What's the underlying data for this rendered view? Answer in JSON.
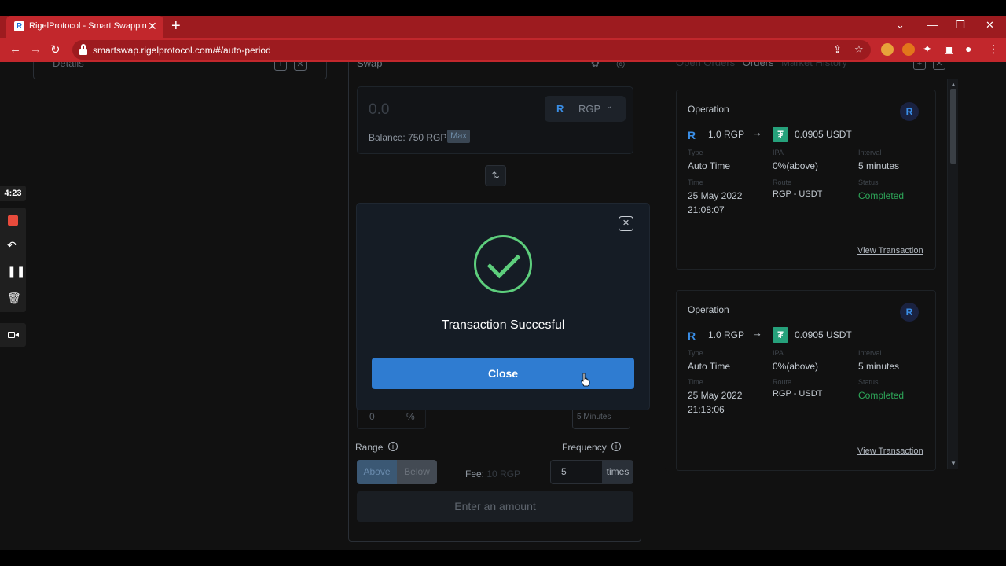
{
  "browser": {
    "tab_title": "RigelProtocol - Smart Swapping",
    "tab_favicon": "R",
    "url": "smartswap.rigelprotocol.com/#/auto-period",
    "accent_color": "#c2272c"
  },
  "recorder": {
    "time": "4:23"
  },
  "details_panel": {
    "title": "Details"
  },
  "swap": {
    "title": "Swap",
    "amount_placeholder": "0.0",
    "token": "RGP",
    "balance": "Balance: 750 RGP",
    "max_label": "Max",
    "percent_value": "0",
    "percent_sign": "%",
    "interval_value": "5 Minutes",
    "range_label": "Range",
    "range_above": "Above",
    "range_below": "Below",
    "fee_label": "Fee:",
    "fee_value": "10 RGP",
    "frequency_label": "Frequency",
    "frequency_value": "5",
    "frequency_unit": "times",
    "enter_amount": "Enter an amount"
  },
  "orders": {
    "tabs": [
      "Open Orders",
      "Orders",
      "Market History"
    ],
    "cards": [
      {
        "operation": "Operation",
        "from": "1.0 RGP",
        "to": "0.0905 USDT",
        "type_label": "Type",
        "type": "Auto Time",
        "ipa_label": "IPA",
        "ipa": "0%(above)",
        "interval_label": "Interval",
        "interval": "5 minutes",
        "time_label": "Time",
        "date": "25 May 2022",
        "time": "21:08:07",
        "route_label": "Route",
        "route": "RGP - USDT",
        "status_label": "Status",
        "status": "Completed",
        "view": "View Transaction"
      },
      {
        "operation": "Operation",
        "from": "1.0 RGP",
        "to": "0.0905 USDT",
        "type_label": "Type",
        "type": "Auto Time",
        "ipa_label": "IPA",
        "ipa": "0%(above)",
        "interval_label": "Interval",
        "interval": "5 minutes",
        "time_label": "Time",
        "date": "25 May 2022",
        "time": "21:13:06",
        "route_label": "Route",
        "route": "RGP - USDT",
        "status_label": "Status",
        "status": "Completed",
        "view": "View Transaction"
      }
    ]
  },
  "modal": {
    "message": "Transaction Succesful",
    "button": "Close",
    "success_color": "#5dce7c",
    "button_color": "#2f7cd1"
  }
}
